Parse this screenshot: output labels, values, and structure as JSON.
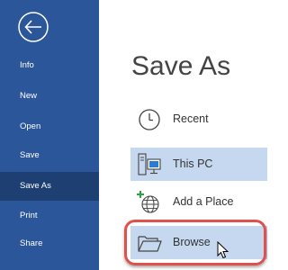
{
  "sidebar": {
    "back_icon": "back-arrow-icon",
    "items": [
      {
        "label": "Info",
        "active": false
      },
      {
        "label": "New",
        "active": false
      },
      {
        "label": "Open",
        "active": false
      },
      {
        "label": "Save",
        "active": false
      },
      {
        "label": "Save As",
        "active": true
      },
      {
        "label": "Print",
        "active": false
      },
      {
        "label": "Share",
        "active": false
      }
    ]
  },
  "main": {
    "title": "Save As",
    "options": [
      {
        "label": "Recent",
        "icon": "clock-icon",
        "selected": false
      },
      {
        "label": "This PC",
        "icon": "computer-icon",
        "selected": true
      },
      {
        "label": "Add a Place",
        "icon": "globe-add-icon",
        "selected": false
      },
      {
        "label": "Browse",
        "icon": "folder-icon",
        "selected": true,
        "highlighted": true
      }
    ]
  },
  "colors": {
    "sidebar_bg": "#2b579a",
    "sidebar_active": "#1e3f72",
    "selected_bg": "#c6d8ef",
    "highlight_border": "#e0514d",
    "icon_accent": "#2ea43f"
  }
}
